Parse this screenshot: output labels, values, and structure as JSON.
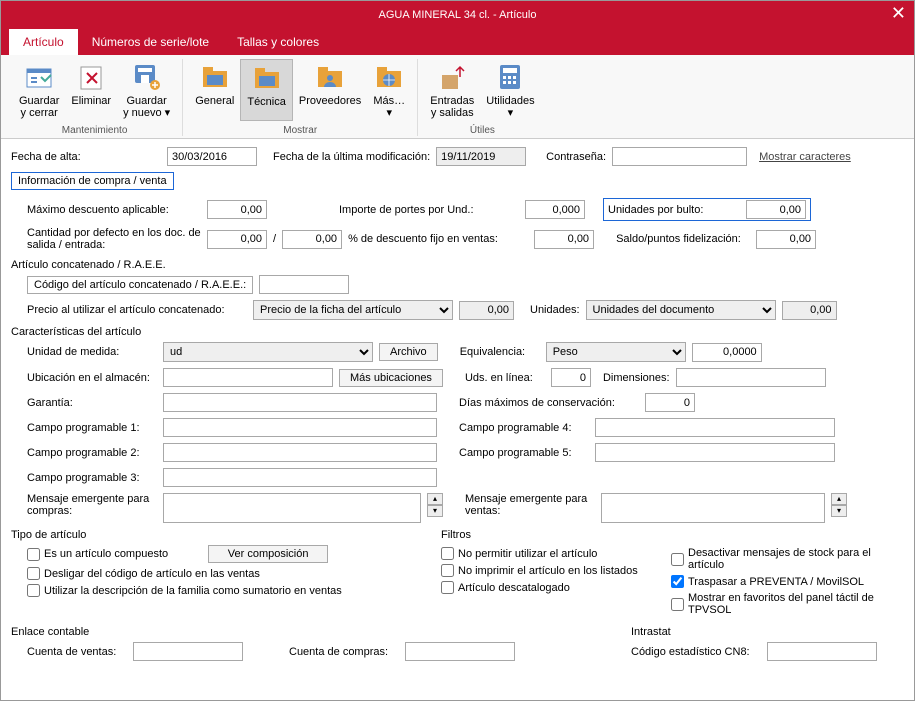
{
  "title": "AGUA MINERAL 34 cl. - Artículo",
  "tabs": [
    "Artículo",
    "Números de serie/lote",
    "Tallas y colores"
  ],
  "ribbon": {
    "grp1": {
      "label": "Mantenimiento",
      "items": [
        {
          "l1": "Guardar",
          "l2": "y cerrar"
        },
        {
          "l1": "Eliminar",
          "l2": ""
        },
        {
          "l1": "Guardar",
          "l2": "y nuevo ▾"
        }
      ]
    },
    "grp2": {
      "label": "Mostrar",
      "items": [
        {
          "l1": "General",
          "l2": ""
        },
        {
          "l1": "Técnica",
          "l2": ""
        },
        {
          "l1": "Proveedores",
          "l2": ""
        },
        {
          "l1": "Más…",
          "l2": "▾"
        }
      ]
    },
    "grp3": {
      "label": "Útiles",
      "items": [
        {
          "l1": "Entradas",
          "l2": "y salidas"
        },
        {
          "l1": "Utilidades",
          "l2": "▾"
        }
      ]
    }
  },
  "fields": {
    "fecha_alta_lbl": "Fecha de alta:",
    "fecha_alta": "30/03/2016",
    "fecha_mod_lbl": "Fecha de la última modificación:",
    "fecha_mod": "19/11/2019",
    "contrasena_lbl": "Contraseña:",
    "mostrar_caracteres": "Mostrar caracteres",
    "section1": "Información de compra / venta",
    "max_desc_lbl": "Máximo descuento aplicable:",
    "max_desc": "0,00",
    "cant_def_lbl": "Cantidad por defecto en los doc. de salida / entrada:",
    "cant_def1": "0,00",
    "cant_def2": "0,00",
    "importe_portes_lbl": "Importe de portes por Und.:",
    "importe_portes": "0,000",
    "desc_fijo_lbl": "% de descuento fijo en ventas:",
    "desc_fijo": "0,00",
    "und_bulto_lbl": "Unidades por bulto:",
    "und_bulto": "0,00",
    "saldo_lbl": "Saldo/puntos fidelización:",
    "saldo": "0,00",
    "concat_title": "Artículo concatenado / R.A.E.E.",
    "concat_code_lbl": "Código del artículo concatenado / R.A.E.E.:",
    "precio_concat_lbl": "Precio al utilizar el artículo concatenado:",
    "precio_concat_sel": "Precio de la ficha del artículo",
    "precio_concat_val": "0,00",
    "unidades_lbl": "Unidades:",
    "unidades_sel": "Unidades del documento",
    "unidades_val": "0,00",
    "caract_title": "Características del artículo",
    "unidad_medida_lbl": "Unidad de medida:",
    "unidad_medida": "ud",
    "archivo_btn": "Archivo",
    "equiv_lbl": "Equivalencia:",
    "equiv_sel": "Peso",
    "equiv_val": "0,0000",
    "ubicacion_lbl": "Ubicación en el almacén:",
    "mas_ubic_btn": "Más ubicaciones",
    "uds_linea_lbl": "Uds. en línea:",
    "uds_linea": "0",
    "dim_lbl": "Dimensiones:",
    "garantia_lbl": "Garantía:",
    "dias_max_lbl": "Días máximos de conservación:",
    "dias_max": "0",
    "cp1": "Campo programable 1:",
    "cp2": "Campo programable 2:",
    "cp3": "Campo programable 3:",
    "cp4": "Campo programable 4:",
    "cp5": "Campo programable 5:",
    "msg_compras_lbl": "Mensaje emergente para compras:",
    "msg_ventas_lbl": "Mensaje emergente para ventas:",
    "tipo_title": "Tipo de artículo",
    "filtros_title": "Filtros",
    "cb1": "Es un artículo compuesto",
    "ver_comp": "Ver composición",
    "cb2": "Desligar del código de artículo en las ventas",
    "cb3": "Utilizar la descripción de la familia como sumatorio en ventas",
    "cb4": "No permitir utilizar el artículo",
    "cb5": "No imprimir el artículo en los listados",
    "cb6": "Artículo descatalogado",
    "cb7": "Desactivar mensajes de stock para el artículo",
    "cb8": "Traspasar a PREVENTA / MovilSOL",
    "cb9": "Mostrar en favoritos del panel táctil de TPVSOL",
    "enlace_title": "Enlace contable",
    "intrastat_title": "Intrastat",
    "cv_lbl": "Cuenta de ventas:",
    "cc_lbl": "Cuenta de compras:",
    "cn8_lbl": "Código estadístico CN8:"
  }
}
